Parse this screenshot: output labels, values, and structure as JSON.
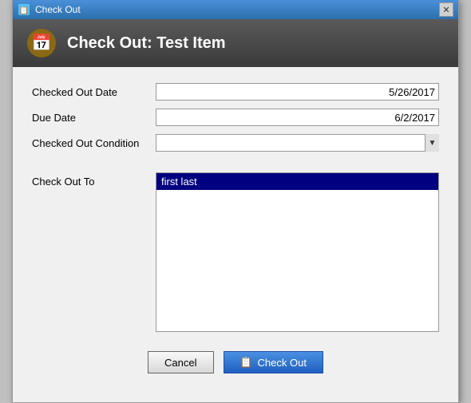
{
  "window": {
    "title": "Check Out",
    "header_title": "Check Out: Test Item"
  },
  "form": {
    "checked_out_date_label": "Checked Out Date",
    "checked_out_date_value": "5/26/2017",
    "due_date_label": "Due Date",
    "due_date_value": "6/2/2017",
    "checked_out_condition_label": "Checked Out Condition",
    "checked_out_condition_value": "",
    "check_out_to_label": "Check Out To",
    "check_out_to_selected": "first last"
  },
  "buttons": {
    "cancel_label": "Cancel",
    "checkout_label": "Check Out"
  }
}
